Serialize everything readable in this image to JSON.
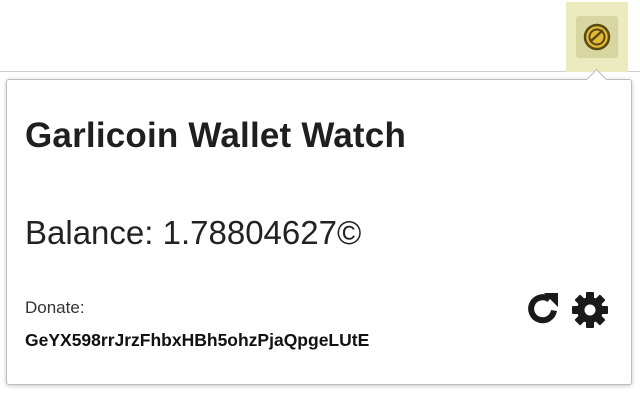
{
  "extension": {
    "icon": "garlicoin-icon",
    "accent_color": "#ecebc0"
  },
  "popup": {
    "title": "Garlicoin Wallet Watch",
    "balance": {
      "label": "Balance:",
      "value": "1.78804627",
      "currency_symbol": "©"
    },
    "donate": {
      "label": "Donate:",
      "address": "GeYX598rrJrzFhbxHBh5ohzPjaQpgeLUtE"
    },
    "actions": {
      "refresh_icon": "refresh-icon",
      "settings_icon": "gear-icon"
    }
  }
}
